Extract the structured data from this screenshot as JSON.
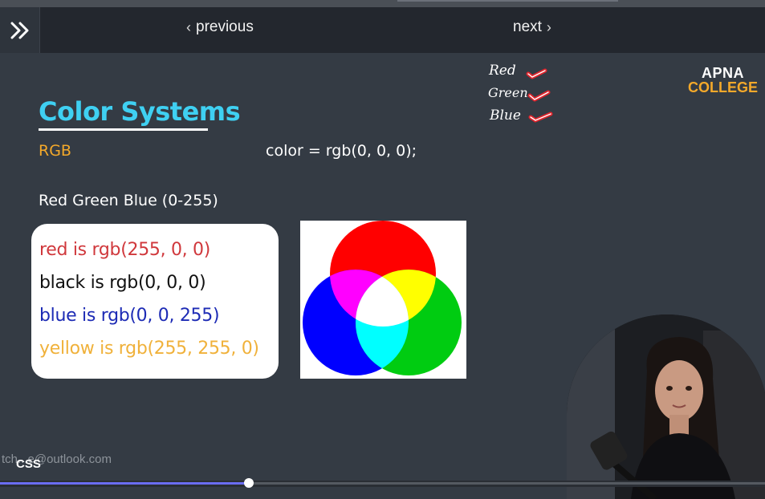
{
  "nav": {
    "previous_label": "previous",
    "next_label": "next",
    "menu_icon": "double-chevron-right-icon"
  },
  "slide": {
    "title": "Color Systems",
    "subtitle": "RGB",
    "code": "color = rgb(0, 0, 0);",
    "range_text": "Red Green Blue (0-255)",
    "examples": [
      {
        "text": "red is rgb(255, 0, 0)",
        "color": "#d0383c"
      },
      {
        "text": "black is rgb(0, 0, 0)",
        "color": "#111111"
      },
      {
        "text": "blue is rgb(0, 0, 255)",
        "color": "#1d2bb5"
      },
      {
        "text": "yellow is rgb(255, 255, 0)",
        "color": "#f0b13a"
      }
    ],
    "handwritten_notes": [
      "Red",
      "Green",
      "Blue"
    ],
    "logo": {
      "line1": "APNA",
      "line2": "COLLEGE"
    }
  },
  "footer": {
    "email": "tch...e@outlook.com",
    "tag": "CSS"
  },
  "player": {
    "progress_fraction": 0.325
  },
  "colors": {
    "title": "#3fd0f2",
    "accent": "#f4a92a",
    "background": "#343b44",
    "check": "#e0262e"
  }
}
